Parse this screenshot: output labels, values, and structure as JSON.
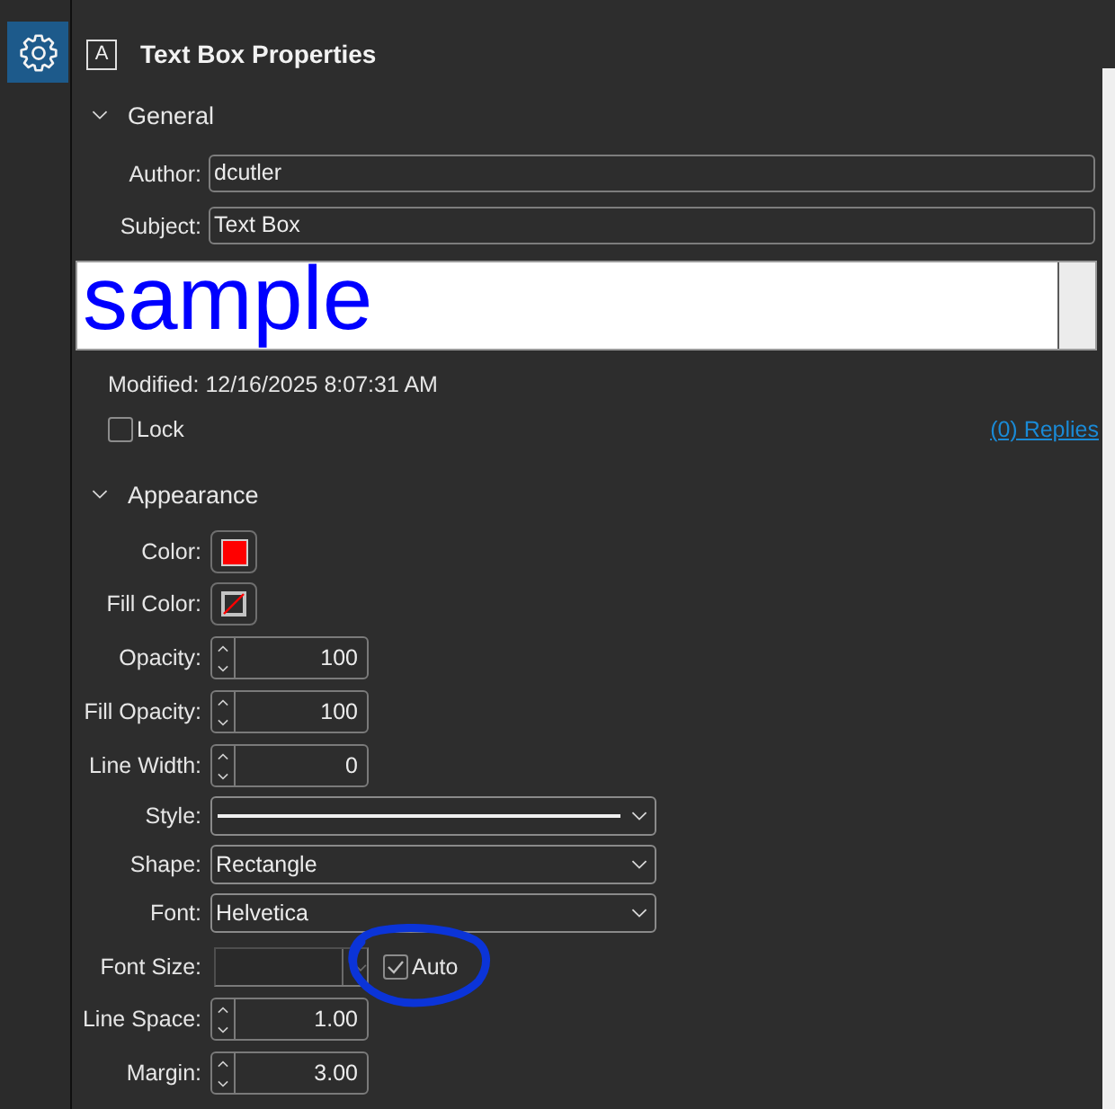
{
  "sidebar": {
    "items": [
      {
        "kind": "settings",
        "selected": true
      }
    ]
  },
  "panel": {
    "type_letter": "A",
    "title": "Text Box Properties"
  },
  "sections": [
    {
      "title": "General",
      "expanded": true,
      "rows": [
        {
          "kind": "text",
          "label": "Author:",
          "value": "dcutler"
        },
        {
          "kind": "text",
          "label": "Subject:",
          "value": "Text Box"
        },
        {
          "kind": "preview",
          "text": "sample",
          "color": "#0000ff"
        },
        {
          "kind": "info",
          "text": "Modified: 12/16/2025 8:07:31 AM"
        },
        {
          "kind": "lock",
          "label": "Lock",
          "checked": false,
          "link": "(0) Replies"
        }
      ]
    },
    {
      "title": "Appearance",
      "expanded": true,
      "rows": [
        {
          "kind": "swatch",
          "label": "Color:",
          "color": "#ff0000",
          "transparent": false
        },
        {
          "kind": "swatch",
          "label": "Fill Color:",
          "transparent": true
        },
        {
          "kind": "spinner",
          "label": "Opacity:",
          "value": "100"
        },
        {
          "kind": "spinner",
          "label": "Fill Opacity:",
          "value": "100"
        },
        {
          "kind": "spinner",
          "label": "Line Width:",
          "value": "0"
        },
        {
          "kind": "line-style",
          "label": "Style:"
        },
        {
          "kind": "dropdown",
          "label": "Shape:",
          "value": "Rectangle"
        },
        {
          "kind": "dropdown",
          "label": "Font:",
          "value": "Helvetica"
        },
        {
          "kind": "font-size",
          "label": "Font Size:",
          "disabled": true,
          "auto_label": "Auto",
          "auto_checked": true,
          "circled": true
        },
        {
          "kind": "spinner",
          "label": "Line Space:",
          "value": "1.00"
        },
        {
          "kind": "spinner",
          "label": "Margin:",
          "value": "3.00"
        }
      ]
    }
  ]
}
